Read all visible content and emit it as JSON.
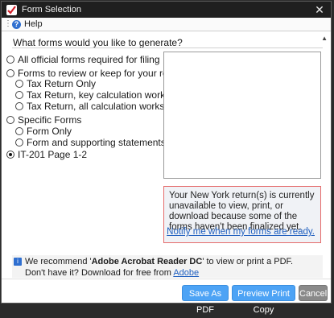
{
  "window": {
    "title": "Form Selection",
    "close_glyph": "✕"
  },
  "menu": {
    "help_label": "Help",
    "help_icon": "?"
  },
  "question": "What forms would you like to generate?",
  "options": [
    {
      "label": "All official forms required for filing",
      "checked": false
    },
    {
      "label": "Forms to review or keep for your records",
      "checked": false
    },
    {
      "label": "Tax Return Only",
      "checked": false
    },
    {
      "label": "Tax Return, key calculation worksheets",
      "checked": false
    },
    {
      "label": "Tax Return, all calculation worksheets",
      "checked": false
    },
    {
      "label": "Specific Forms",
      "checked": false
    },
    {
      "label": "Form Only",
      "checked": false
    },
    {
      "label": "Form and supporting statements",
      "checked": false
    },
    {
      "label": "IT-201 Page 1-2",
      "checked": true
    }
  ],
  "notice": {
    "text": "Your New York return(s) is currently unavailable to view, print, or download because some of the forms haven't been finalized yet.",
    "link": "Notify me when my forms are ready."
  },
  "recommendation": {
    "prefix": "We recommend '",
    "product": "Adobe Acrobat Reader DC",
    "suffix": "' to view or print a PDF.",
    "line2_prefix": "Don't have it? Download for free from ",
    "line2_link": "Adobe"
  },
  "buttons": {
    "save_pdf": "Save As PDF",
    "preview": "Preview Print Copy",
    "cancel": "Cancel"
  },
  "colors": {
    "accent_blue": "#4da3f5",
    "notice_border": "#e56b6b",
    "link": "#1f5fbf"
  }
}
